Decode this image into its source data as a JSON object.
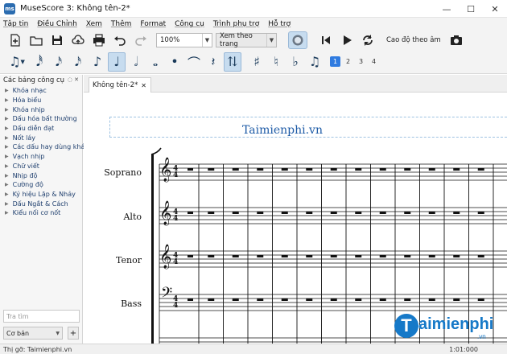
{
  "window": {
    "title": "MuseScore 3: Không tên-2*",
    "app_icon": "ms"
  },
  "menu": [
    "Tập tin",
    "Điều Chỉnh",
    "Xem",
    "Thêm",
    "Format",
    "Công cụ",
    "Trình phụ trợ",
    "Hỗ trợ"
  ],
  "toolbar": {
    "zoom_value": "100%",
    "view_mode": "Xem theo trang",
    "pitch_label": "Cao độ theo âm"
  },
  "note_input": {
    "voices": [
      "1",
      "2",
      "3",
      "4"
    ],
    "active_voice": "1"
  },
  "palette": {
    "title": "Các bảng công cụ",
    "items": [
      "Khóa nhạc",
      "Hóa biểu",
      "Khóa nhịp",
      "Dấu hóa bất thường",
      "Dấu diễn đạt",
      "Nốt láy",
      "Các dấu hay dùng khác",
      "Vạch nhịp",
      "Chữ viết",
      "Nhịp độ",
      "Cường độ",
      "Ký hiệu Lặp & Nhảy",
      "Dấu Ngắt & Cách",
      "Kiểu nối cơ nốt"
    ],
    "search_placeholder": "Tra tìm",
    "workspace": "Cơ bản",
    "add_label": "+"
  },
  "score": {
    "tab_label": "Không tên-2*",
    "title": "Taimienphi.vn",
    "instruments": [
      "Soprano",
      "Alto",
      "Tenor",
      "Bass"
    ],
    "time_signature": "4/4"
  },
  "status": {
    "left": "Thị gỡ: Taimienphi.vn",
    "time": "1:01:000"
  },
  "watermark": {
    "letter": "T",
    "text": "aimienphi",
    "suffix": ".vn"
  },
  "colors": {
    "title_blue": "#1c5aa6",
    "active_voice": "#2f7be0",
    "watermark": "#1679c8"
  }
}
